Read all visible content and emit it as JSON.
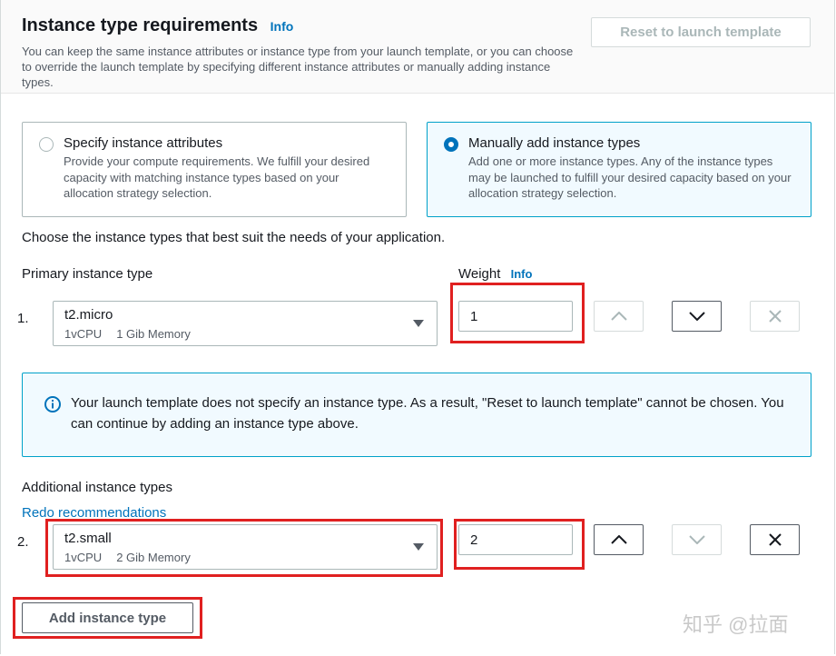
{
  "header": {
    "title": "Instance type requirements",
    "info_label": "Info",
    "description": "You can keep the same instance attributes or instance type from your launch template, or you can choose to override the launch template by specifying different instance attributes or manually adding instance types.",
    "reset_button": "Reset to launch template"
  },
  "options": [
    {
      "title": "Specify instance attributes",
      "description": "Provide your compute requirements. We fulfill your desired capacity with matching instance types based on your allocation strategy selection.",
      "selected": false
    },
    {
      "title": "Manually add instance types",
      "description": "Add one or more instance types. Any of the instance types may be launched to fulfill your desired capacity based on your allocation strategy selection.",
      "selected": true
    }
  ],
  "instructions": "Choose the instance types that best suit the needs of your application.",
  "primary": {
    "label": "Primary instance type",
    "weight_label": "Weight",
    "weight_info": "Info",
    "index": "1.",
    "instance_type": "t2.micro",
    "vcpu": "1vCPU",
    "memory": "1 Gib Memory",
    "weight": "1"
  },
  "alert": {
    "text": "Your launch template does not specify an instance type. As a result, \"Reset to launch template\" cannot be chosen. You can continue by adding an instance type above."
  },
  "additional": {
    "label": "Additional instance types",
    "redo_link": "Redo recommendations",
    "index": "2.",
    "instance_type": "t2.small",
    "vcpu": "1vCPU",
    "memory": "2 Gib Memory",
    "weight": "2"
  },
  "add_button": "Add instance type",
  "watermark": "知乎 @拉面",
  "colors": {
    "accent": "#0073bb",
    "selected_border": "#00a1c9",
    "highlight": "#e02020"
  }
}
